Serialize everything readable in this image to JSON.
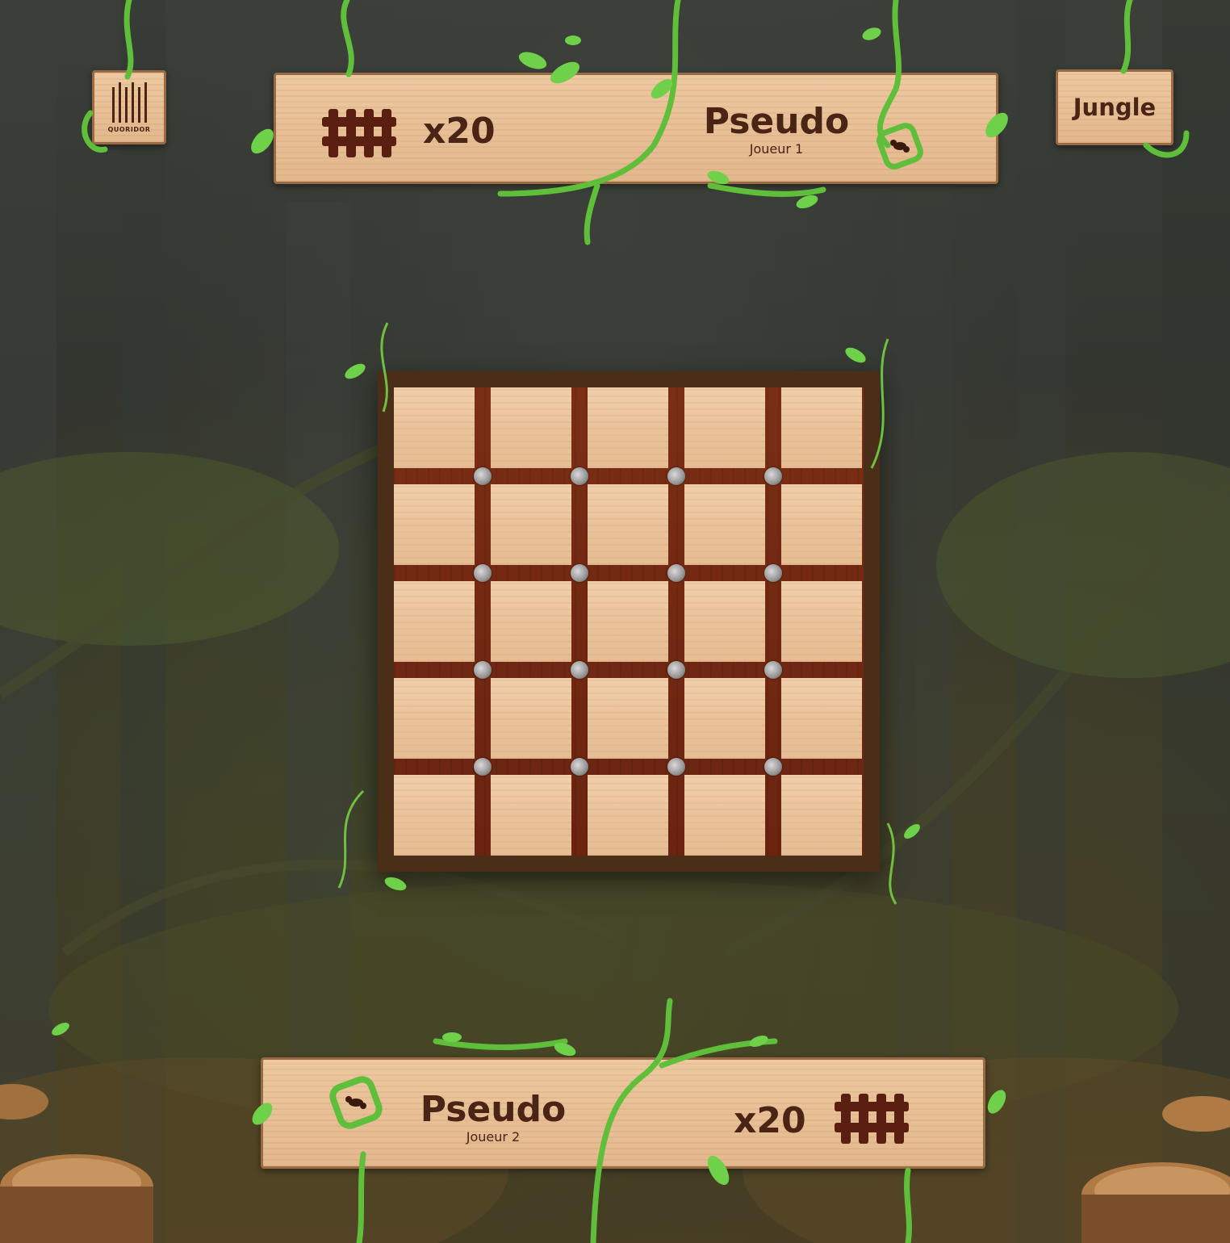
{
  "logo": {
    "text": "QUORIDOR",
    "icon": "barcode-logo-icon"
  },
  "theme_button": {
    "label": "Jungle"
  },
  "player1": {
    "walls": "x20",
    "name": "Pseudo",
    "role": "Joueur 1",
    "avatar_icon": "ant-avatar-icon",
    "wall_icon": "fence-icon"
  },
  "player2": {
    "walls": "x20",
    "name": "Pseudo",
    "role": "Joueur 2",
    "avatar_icon": "ant-avatar-icon",
    "wall_icon": "fence-icon"
  },
  "board": {
    "rows": 5,
    "cols": 5,
    "pegs_per_side": 4
  },
  "colors": {
    "wood_light": "#ecc8a0",
    "wood_dark": "#4a2415",
    "board_frame": "#4a2e17",
    "groove": "#7a2e14",
    "vine": "#5fbf3a"
  }
}
